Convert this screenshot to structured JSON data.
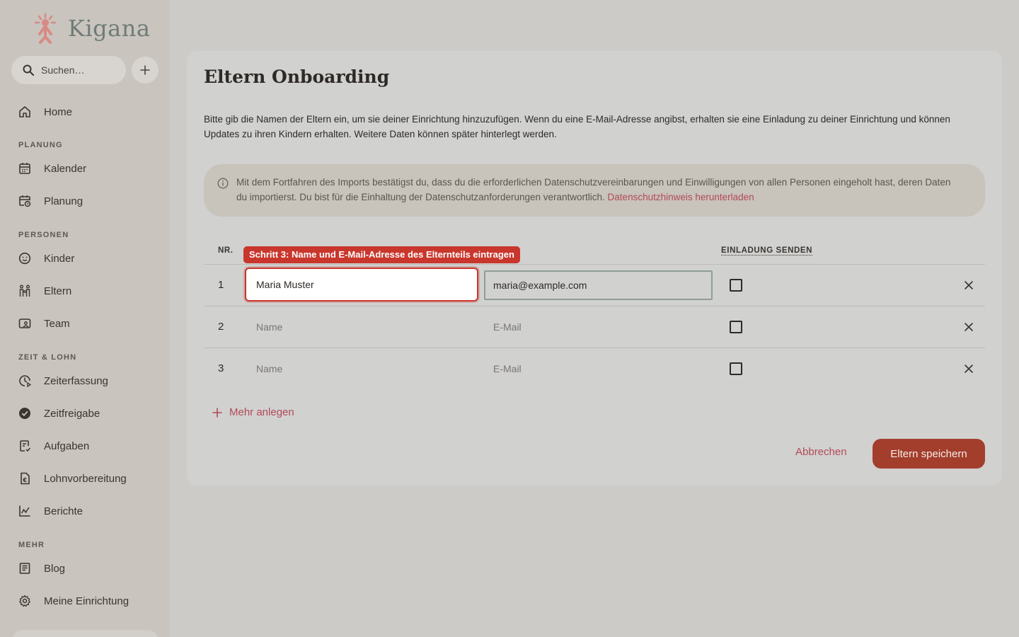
{
  "app": {
    "name": "Kigana"
  },
  "search": {
    "placeholder": "Suchen…"
  },
  "sidebar": {
    "home": "Home",
    "sections": {
      "planung": "PLANUNG",
      "personen": "PERSONEN",
      "zeit": "ZEIT & LOHN",
      "mehr": "MEHR"
    },
    "items": {
      "kalender": "Kalender",
      "planung": "Planung",
      "kinder": "Kinder",
      "eltern": "Eltern",
      "team": "Team",
      "zeiterfassung": "Zeiterfassung",
      "zeitfreigabe": "Zeitfreigabe",
      "aufgaben": "Aufgaben",
      "lohnvorbereitung": "Lohnvorbereitung",
      "berichte": "Berichte",
      "blog": "Blog",
      "einrichtung": "Meine Einrichtung"
    }
  },
  "main": {
    "title": "Eltern Onboarding",
    "intro": "Bitte gib die Namen der Eltern ein, um sie deiner Einrichtung hinzuzufügen. Wenn du eine E-Mail-Adresse angibst, erhalten sie eine Einladung zu deiner Einrichtung und können Updates zu ihren Kindern erhalten. Weitere Daten können später hinterlegt werden.",
    "notice": {
      "text": "Mit dem Fortfahren des Imports bestätigst du, dass du die erforderlichen Datenschutzvereinbarungen und Einwilligungen von allen Personen eingeholt hast, deren Daten du importierst. Du bist für die Einhaltung der Datenschutzanforderungen verantwortlich.",
      "link": "Datenschutzhinweis herunterladen"
    },
    "table": {
      "col_nr": "NR.",
      "col_invite": "EINLADUNG SENDEN",
      "hint": "Schritt 3: Name und E-Mail-Adresse des Elternteils eintragen",
      "rows": [
        {
          "nr": "1",
          "name": "Maria Muster",
          "email": "maria@example.com"
        },
        {
          "nr": "2",
          "name_placeholder": "Name",
          "email_placeholder": "E-Mail"
        },
        {
          "nr": "3",
          "name_placeholder": "Name",
          "email_placeholder": "E-Mail"
        }
      ]
    },
    "add_more": "Mehr anlegen",
    "cancel": "Abbrechen",
    "save": "Eltern speichern"
  },
  "colors": {
    "accent": "#b24a58",
    "primary_button": "#a33e2c",
    "highlight": "#c9362c"
  }
}
